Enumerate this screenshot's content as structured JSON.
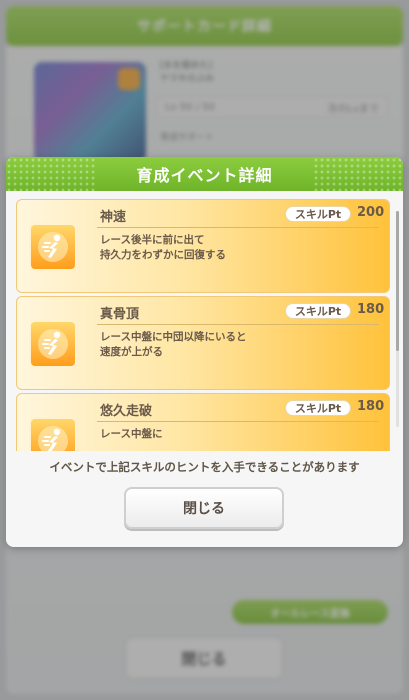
{
  "background": {
    "header_title": "サポートカード詳細",
    "card_name_line1": "[水を極めた]",
    "card_name_line2": "ヤマキのぶみ",
    "level_text": "Lv 50 / 50",
    "level_extra": "次のLvまで",
    "card_type": "育成サポート",
    "green_button_label": "オールレース変換",
    "close_button_label": "閉じる"
  },
  "modal": {
    "title": "育成イベント詳細",
    "hint_text": "イベントで上記スキルのヒントを入手できることがあります",
    "close_button_label": "閉じる",
    "skills": [
      {
        "name": "神速",
        "pt_label": "スキルPt",
        "pt_value": "200",
        "desc1": "レース後半に前に出て",
        "desc2": "持久力をわずかに回復する"
      },
      {
        "name": "真骨頂",
        "pt_label": "スキルPt",
        "pt_value": "180",
        "desc1": "レース中盤に中団以降にいると",
        "desc2": "速度が上がる"
      },
      {
        "name": "悠久走破",
        "pt_label": "スキルPt",
        "pt_value": "180",
        "desc1": "レース中盤に",
        "desc2": ""
      }
    ]
  },
  "colors": {
    "header_green": "#7cc234",
    "skill_gold": "#ffc23b",
    "text_brown": "#6a5a4a"
  }
}
